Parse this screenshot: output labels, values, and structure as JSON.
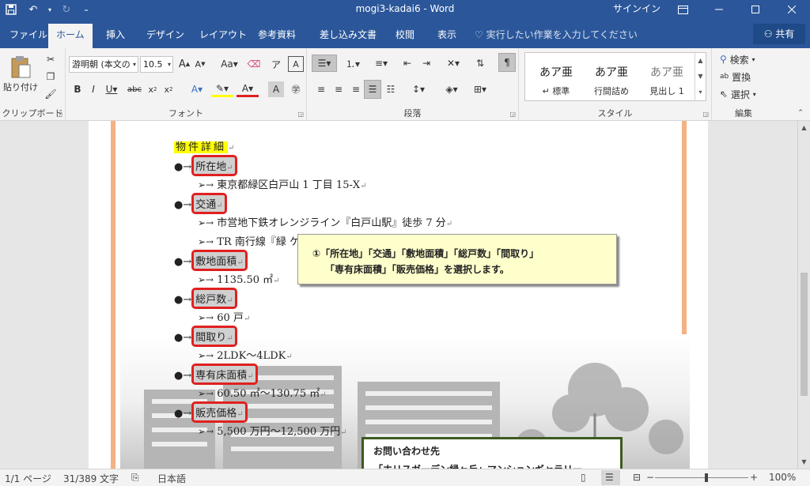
{
  "titlebar": {
    "title": "mogi3-kadai6  -  Word",
    "signin": "サインイン"
  },
  "tabs": [
    "ファイル",
    "ホーム",
    "挿入",
    "デザイン",
    "レイアウト",
    "参考資料",
    "差し込み文書",
    "校閲",
    "表示"
  ],
  "tellme": "実行したい作業を入力してください",
  "share": "共有",
  "ribbon": {
    "clipboard": {
      "paste": "貼り付け",
      "label": "クリップボード"
    },
    "font": {
      "name": "游明朝 (本文の",
      "size": "10.5",
      "label": "フォント"
    },
    "paragraph": {
      "label": "段落"
    },
    "styles": {
      "label": "スタイル",
      "items": [
        {
          "sample": "あア亜",
          "name": "↵ 標準"
        },
        {
          "sample": "あア亜",
          "name": "行間詰め"
        },
        {
          "sample": "あア亜",
          "name": "見出し 1"
        }
      ]
    },
    "editing": {
      "find": "検索",
      "replace": "置換",
      "select": "選択",
      "label": "編集"
    }
  },
  "document": {
    "heading": "物件詳細",
    "items": [
      {
        "label": "所在地",
        "details": [
          "東京都緑区白戸山 1 丁目 15-X"
        ]
      },
      {
        "label": "交通",
        "details": [
          "市営地下鉄オレンジライン『白戸山駅』徒歩 7 分",
          "TR 南行線『緑 ケ"
        ]
      },
      {
        "label": "敷地面積",
        "details": [
          "1135.50 ㎡"
        ]
      },
      {
        "label": "総戸数",
        "details": [
          "60 戸"
        ]
      },
      {
        "label": "間取り",
        "details": [
          "2LDK～4LDK"
        ]
      },
      {
        "label": "専有床面積",
        "details": [
          "60.50 ㎡～130.75 ㎡"
        ]
      },
      {
        "label": "販売価格",
        "details": [
          "5,500 万円～12,500 万円"
        ]
      }
    ],
    "callout": {
      "line1": "①「所在地」「交通」「敷地面積」「総戸数」「間取り」",
      "line2": "「専有床面積」「販売価格」を選択します。"
    },
    "contact": {
      "title": "お問い合わせ先",
      "line2": "「ホリスガーデン緑ヶ丘」マンションギャラリー"
    }
  },
  "statusbar": {
    "page": "1/1 ページ",
    "words": "31/389 文字",
    "language": "日本語",
    "zoom": "100%"
  }
}
